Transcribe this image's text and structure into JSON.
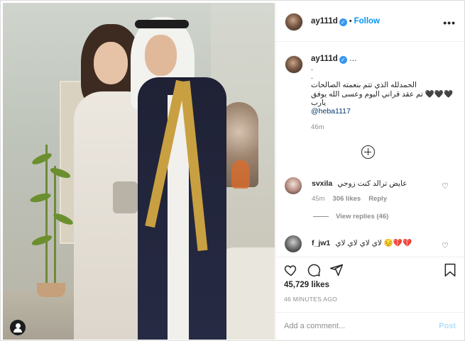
{
  "post": {
    "username": "ay111d",
    "follow_label": "Follow",
    "more_label": "•••"
  },
  "caption": {
    "username": "ay111d",
    "dot_lines": [
      ".",
      "."
    ],
    "text_line_1": "الحمدلله الذي تتم بنعمته الصالحات",
    "text_line_2": "🖤🖤🖤 تم عقد قراني اليوم وعسى الله يوفق يارب",
    "mention": "@heba1117",
    "age": "46m"
  },
  "comments": [
    {
      "username": "svxila",
      "text": "عايض ترالد كنت زوجي",
      "age": "45m",
      "likes": "306 likes",
      "reply_label": "Reply",
      "view_replies": "View replies (46)"
    },
    {
      "username": "f_jw1",
      "text": "لاي لاي لاي لاي 😔💔💔"
    }
  ],
  "footer": {
    "likes": "45,729 likes",
    "time": "46 MINUTES AGO",
    "add_comment_placeholder": "Add a comment...",
    "post_label": "Post"
  },
  "icons": {
    "heart": "heart-icon",
    "comment": "comment-icon",
    "share": "share-icon",
    "save": "bookmark-icon",
    "verified": "verified-badge-icon",
    "tag": "user-tag-icon"
  },
  "colors": {
    "link_blue": "#0095f6",
    "verified_blue": "#3897f0",
    "muted": "#8e8e8e",
    "post_disabled": "#b2dffc"
  }
}
